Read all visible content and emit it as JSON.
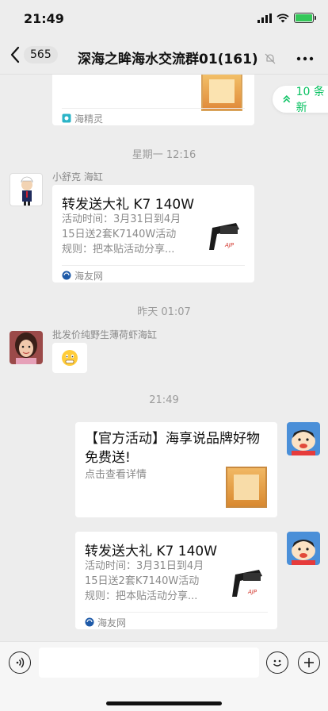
{
  "status_bar": {
    "time": "21:49"
  },
  "nav": {
    "back_count": "565",
    "title": "深海之眸海水交流群01(161)"
  },
  "new_messages": {
    "label": "10 条新"
  },
  "messages": [
    {
      "type": "card_partial",
      "source": "海精灵"
    },
    {
      "type": "timestamp",
      "text": "星期一 12:16"
    },
    {
      "type": "card",
      "sender": "小舒克 海缸",
      "title": "转发送大礼 K7 140W",
      "desc": "活动时间：3月31日到4月\n15日送2套K7140W活动\n规则：把本贴活动分享...",
      "source": "海友网"
    },
    {
      "type": "timestamp",
      "text": "昨天 01:07"
    },
    {
      "type": "emoji",
      "sender": "批发价纯野生薄荷虾海缸"
    },
    {
      "type": "timestamp",
      "text": "21:49"
    },
    {
      "type": "card_self",
      "title": "【官方活动】海享说品牌好物免费送!",
      "desc": "点击查看详情"
    },
    {
      "type": "card_self",
      "title": "转发送大礼 K7 140W",
      "desc": "活动时间：3月31日到4月\n15日送2套K7140W活动\n规则：把本贴活动分享...",
      "source": "海友网"
    }
  ],
  "colors": {
    "accent": "#07c160",
    "background": "#ededed",
    "bubble": "#ffffff"
  },
  "icons": [
    "signal-icon",
    "wifi-icon",
    "battery-icon",
    "back-chevron-icon",
    "muted-bell-icon",
    "more-icon",
    "voice-icon",
    "emoji-icon",
    "add-icon"
  ]
}
